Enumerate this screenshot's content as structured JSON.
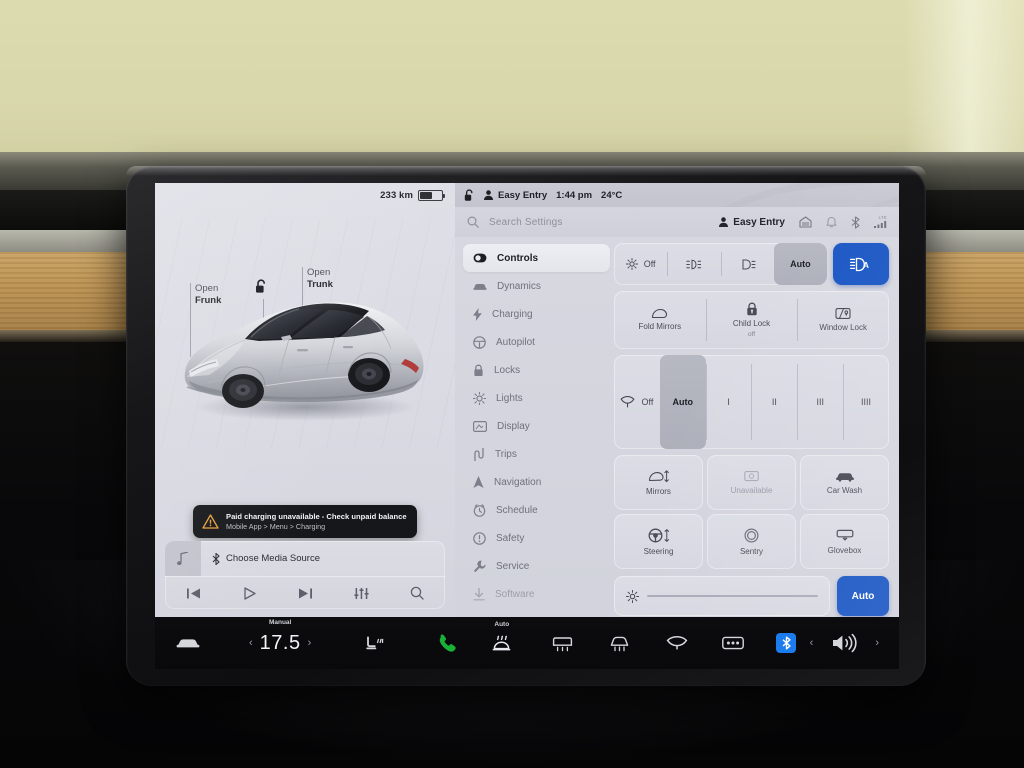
{
  "vehicle_panel": {
    "range": "233 km",
    "battery_percent": 52,
    "frunk_label_line1": "Open",
    "frunk_label_line2": "Frunk",
    "trunk_label_line1": "Open",
    "trunk_label_line2": "Trunk",
    "lock_icon": "unlocked-padlock-icon",
    "charge_icon": "lightning-bolt-icon",
    "car_icon": "tesla-model-3-render"
  },
  "alert": {
    "icon": "warning-triangle-icon",
    "title": "Paid charging unavailable - Check unpaid balance",
    "subtitle": "Mobile App > Menu > Charging"
  },
  "media": {
    "thumb_icon": "music-note-icon",
    "source_icon": "bluetooth-icon",
    "source_label": "Choose Media Source",
    "controls": [
      {
        "name": "previous-track-button",
        "icon": "skip-back-icon"
      },
      {
        "name": "play-button",
        "icon": "play-icon"
      },
      {
        "name": "next-track-button",
        "icon": "skip-forward-icon"
      },
      {
        "name": "equalizer-button",
        "icon": "equalizer-icon"
      },
      {
        "name": "media-search-button",
        "icon": "search-icon"
      }
    ]
  },
  "status_strip": {
    "lock_icon": "unlocked-padlock-icon",
    "driver_icon": "person-icon",
    "driver_profile": "Easy Entry",
    "time": "1:44 pm",
    "temperature": "24°C"
  },
  "search": {
    "icon": "search-icon",
    "placeholder": "Search Settings",
    "profile_icon": "person-icon",
    "profile_label": "Easy Entry",
    "icons": [
      "garage-door-icon",
      "bell-icon",
      "bluetooth-icon",
      "lte-signal-icon"
    ],
    "signal_label": "LTE"
  },
  "sidebar": {
    "items": [
      {
        "label": "Controls",
        "icon": "toggle-switch-icon",
        "active": true
      },
      {
        "label": "Dynamics",
        "icon": "car-icon",
        "active": false
      },
      {
        "label": "Charging",
        "icon": "lightning-bolt-icon",
        "active": false
      },
      {
        "label": "Autopilot",
        "icon": "steering-wheel-icon",
        "active": false
      },
      {
        "label": "Locks",
        "icon": "padlock-icon",
        "active": false
      },
      {
        "label": "Lights",
        "icon": "sun-brightness-icon",
        "active": false
      },
      {
        "label": "Display",
        "icon": "display-icon",
        "active": false
      },
      {
        "label": "Trips",
        "icon": "road-icon",
        "active": false
      },
      {
        "label": "Navigation",
        "icon": "navigation-arrow-icon",
        "active": false
      },
      {
        "label": "Schedule",
        "icon": "clock-icon",
        "active": false
      },
      {
        "label": "Safety",
        "icon": "exclamation-circle-icon",
        "active": false
      },
      {
        "label": "Service",
        "icon": "wrench-icon",
        "active": false
      },
      {
        "label": "Software",
        "icon": "download-arrow-icon",
        "active": false
      }
    ]
  },
  "controls": {
    "lights_row": [
      {
        "label": "Off",
        "icon": "sun-brightness-icon",
        "selected": false
      },
      {
        "label": "",
        "icon": "parking-lights-icon",
        "selected": false
      },
      {
        "label": "",
        "icon": "headlight-icon",
        "selected": false
      },
      {
        "label": "Auto",
        "icon": "",
        "selected": true
      }
    ],
    "high_beam_button": {
      "icon": "auto-high-beam-icon",
      "active": true,
      "color": "#1a56c4"
    },
    "mirror_tiles": [
      {
        "label": "Fold Mirrors",
        "sub": "",
        "icon": "mirror-icon"
      },
      {
        "label": "Child Lock",
        "sub": "off",
        "icon": "child-lock-icon"
      },
      {
        "label": "Window Lock",
        "sub": "",
        "icon": "window-lock-icon"
      }
    ],
    "wiper_row": [
      {
        "label": "Off",
        "icon": "wiper-icon",
        "selected": false
      },
      {
        "label": "Auto",
        "icon": "",
        "selected": true
      },
      {
        "label": "I",
        "icon": "",
        "selected": false
      },
      {
        "label": "II",
        "icon": "",
        "selected": false
      },
      {
        "label": "III",
        "icon": "",
        "selected": false
      },
      {
        "label": "IIII",
        "icon": "",
        "selected": false
      }
    ],
    "grid_cells": [
      {
        "label": "Mirrors",
        "icon": "mirror-adjust-icon",
        "dim": false
      },
      {
        "label": "Unavailable",
        "icon": "camera-icon",
        "dim": true
      },
      {
        "label": "Car Wash",
        "icon": "car-wash-icon",
        "dim": false
      },
      {
        "label": "Steering",
        "icon": "steering-adjust-icon",
        "dim": false
      },
      {
        "label": "Sentry",
        "icon": "sentry-mode-icon",
        "dim": false
      },
      {
        "label": "Glovebox",
        "icon": "glovebox-icon",
        "dim": false
      }
    ],
    "brightness": {
      "icon": "sun-brightness-icon",
      "value_percent": 4
    },
    "brightness_auto_button": {
      "label": "Auto",
      "color": "#1a56c4"
    }
  },
  "climate_bar": {
    "car_icon": "car-icon",
    "temp_caption": "Manual",
    "temperature": "17.5",
    "left_chevron": "‹",
    "right_chevron": "›",
    "seat_heater_icon": "heated-seat-icon",
    "phone_icon": "phone-icon",
    "defrost_caption": "Auto",
    "icons": [
      "front-defrost-icon",
      "rear-defrost-icon-1",
      "rear-defrost-icon-2",
      "wiper-icon",
      "more-options-icon"
    ],
    "bluetooth_chip": {
      "icon": "bluetooth-icon",
      "active": true,
      "color": "#1c7ced"
    },
    "volume_icon": "speaker-volume-icon",
    "vol_left_chevron": "‹",
    "vol_right_chevron": "›"
  }
}
